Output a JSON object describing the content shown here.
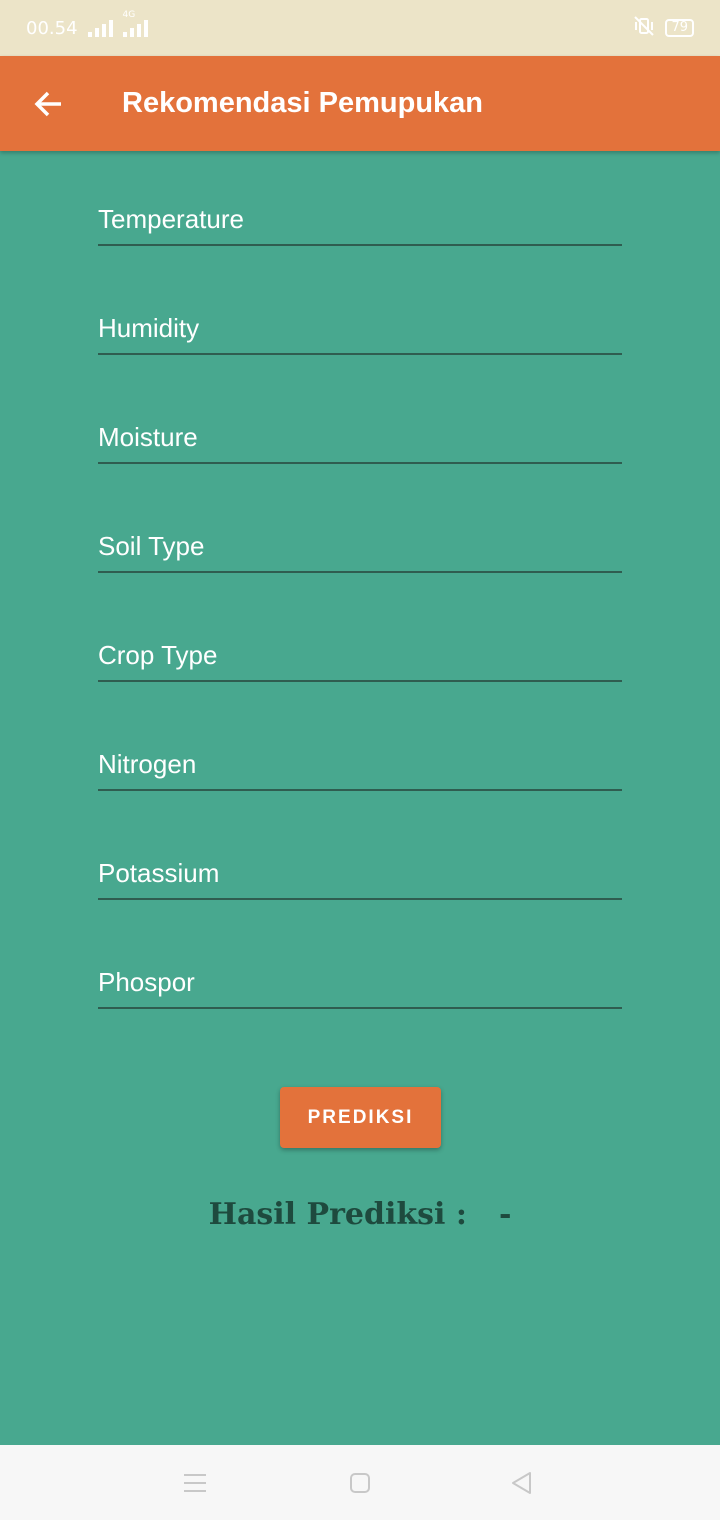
{
  "status_bar": {
    "time": "00.54",
    "network_label": "4G",
    "battery": "79"
  },
  "app_bar": {
    "title": "Rekomendasi Pemupukan",
    "back_icon": "arrow-left-icon"
  },
  "form": {
    "fields": [
      {
        "placeholder": "Temperature",
        "value": ""
      },
      {
        "placeholder": "Humidity",
        "value": ""
      },
      {
        "placeholder": "Moisture",
        "value": ""
      },
      {
        "placeholder": "Soil Type",
        "value": ""
      },
      {
        "placeholder": "Crop Type",
        "value": ""
      },
      {
        "placeholder": "Nitrogen",
        "value": ""
      },
      {
        "placeholder": "Potassium",
        "value": ""
      },
      {
        "placeholder": "Phospor",
        "value": ""
      }
    ],
    "submit_label": "PREDIKSI"
  },
  "result": {
    "label": "Hasil Prediksi :",
    "value": "-"
  },
  "nav_bar": {
    "icons": [
      "menu-icon",
      "home-square-icon",
      "back-triangle-icon"
    ]
  },
  "colors": {
    "background": "#48a88f",
    "accent": "#e3723b",
    "status_bar": "#ece4c8"
  }
}
